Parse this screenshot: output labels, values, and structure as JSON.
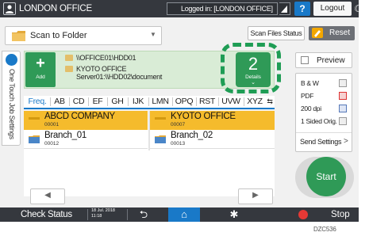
{
  "topbar": {
    "title": "LONDON OFFICE",
    "login_status": "Logged in: [LONDON OFFICE]",
    "help_label": "?",
    "logout_label": "Logout"
  },
  "toolbar": {
    "mode_label": "Scan to Folder",
    "scan_files_status_label": "Scan Files Status",
    "reset_label": "Reset"
  },
  "side_tab": {
    "label": "One Touch Job Settings"
  },
  "destination": {
    "add_label": "Add",
    "lines": [
      "\\\\OFFICE01\\HDD01",
      "KYOTO OFFICE",
      "Server01:\\\\HDD02\\document"
    ],
    "details_count": "2",
    "details_label": "Details"
  },
  "index_tabs": [
    "Freq.",
    "AB",
    "CD",
    "EF",
    "GH",
    "IJK",
    "LMN",
    "OPQ",
    "RST",
    "UVW",
    "XYZ"
  ],
  "destinations": [
    {
      "name": "ABCD COMPANY",
      "number": "00001",
      "selected": true
    },
    {
      "name": "KYOTO OFFICE",
      "number": "00007",
      "selected": true
    },
    {
      "name": "Branch_01",
      "number": "00012",
      "selected": false
    },
    {
      "name": "Branch_02",
      "number": "00013",
      "selected": false
    }
  ],
  "right_panel": {
    "preview_label": "Preview",
    "settings": [
      "B & W",
      "PDF",
      "200 dpi",
      "1 Sided Orig."
    ],
    "send_settings_label": "Send Settings",
    "start_label": "Start"
  },
  "bottombar": {
    "check_status_label": "Check Status",
    "date": "18 Jul. 2018",
    "time": "11:18",
    "stop_label": "Stop"
  },
  "footer": {
    "code": "DZC536"
  },
  "colors": {
    "accent_green": "#2f9a57",
    "selection_orange": "#f5bb2c",
    "topbar_dark": "#35383e",
    "accent_blue": "#1979c8"
  }
}
